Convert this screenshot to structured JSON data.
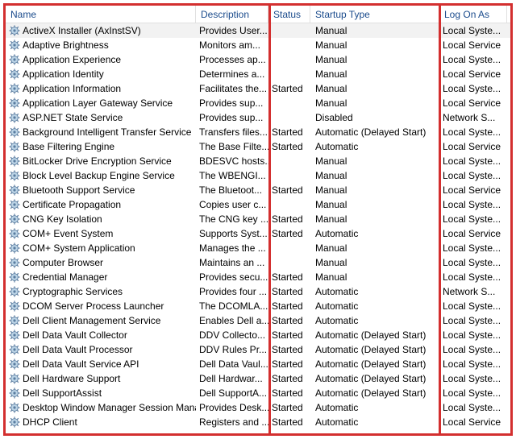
{
  "columns": {
    "name": "Name",
    "description": "Description",
    "status": "Status",
    "startup": "Startup Type",
    "logon": "Log On As"
  },
  "rows": [
    {
      "name": "ActiveX Installer (AxInstSV)",
      "desc": "Provides User...",
      "status": "",
      "startup": "Manual",
      "logon": "Local Syste...",
      "selected": true
    },
    {
      "name": "Adaptive Brightness",
      "desc": "Monitors am...",
      "status": "",
      "startup": "Manual",
      "logon": "Local Service"
    },
    {
      "name": "Application Experience",
      "desc": "Processes ap...",
      "status": "",
      "startup": "Manual",
      "logon": "Local Syste..."
    },
    {
      "name": "Application Identity",
      "desc": "Determines a...",
      "status": "",
      "startup": "Manual",
      "logon": "Local Service"
    },
    {
      "name": "Application Information",
      "desc": "Facilitates the...",
      "status": "Started",
      "startup": "Manual",
      "logon": "Local Syste..."
    },
    {
      "name": "Application Layer Gateway Service",
      "desc": "Provides sup...",
      "status": "",
      "startup": "Manual",
      "logon": "Local Service"
    },
    {
      "name": "ASP.NET State Service",
      "desc": "Provides sup...",
      "status": "",
      "startup": "Disabled",
      "logon": "Network S..."
    },
    {
      "name": "Background Intelligent Transfer Service",
      "desc": "Transfers files...",
      "status": "Started",
      "startup": "Automatic (Delayed Start)",
      "logon": "Local Syste..."
    },
    {
      "name": "Base Filtering Engine",
      "desc": "The Base Filte...",
      "status": "Started",
      "startup": "Automatic",
      "logon": "Local Service"
    },
    {
      "name": "BitLocker Drive Encryption Service",
      "desc": "BDESVC hosts...",
      "status": "",
      "startup": "Manual",
      "logon": "Local Syste..."
    },
    {
      "name": "Block Level Backup Engine Service",
      "desc": "The WBENGI...",
      "status": "",
      "startup": "Manual",
      "logon": "Local Syste..."
    },
    {
      "name": "Bluetooth Support Service",
      "desc": "The Bluetoot...",
      "status": "Started",
      "startup": "Manual",
      "logon": "Local Service"
    },
    {
      "name": "Certificate Propagation",
      "desc": "Copies user c...",
      "status": "",
      "startup": "Manual",
      "logon": "Local Syste..."
    },
    {
      "name": "CNG Key Isolation",
      "desc": "The CNG key ...",
      "status": "Started",
      "startup": "Manual",
      "logon": "Local Syste..."
    },
    {
      "name": "COM+ Event System",
      "desc": "Supports Syst...",
      "status": "Started",
      "startup": "Automatic",
      "logon": "Local Service"
    },
    {
      "name": "COM+ System Application",
      "desc": "Manages the ...",
      "status": "",
      "startup": "Manual",
      "logon": "Local Syste..."
    },
    {
      "name": "Computer Browser",
      "desc": "Maintains an ...",
      "status": "",
      "startup": "Manual",
      "logon": "Local Syste..."
    },
    {
      "name": "Credential Manager",
      "desc": "Provides secu...",
      "status": "Started",
      "startup": "Manual",
      "logon": "Local Syste..."
    },
    {
      "name": "Cryptographic Services",
      "desc": "Provides four ...",
      "status": "Started",
      "startup": "Automatic",
      "logon": "Network S..."
    },
    {
      "name": "DCOM Server Process Launcher",
      "desc": "The DCOMLA...",
      "status": "Started",
      "startup": "Automatic",
      "logon": "Local Syste..."
    },
    {
      "name": "Dell Client Management Service",
      "desc": "Enables Dell a...",
      "status": "Started",
      "startup": "Automatic",
      "logon": "Local Syste..."
    },
    {
      "name": "Dell Data Vault Collector",
      "desc": "DDV Collecto...",
      "status": "Started",
      "startup": "Automatic (Delayed Start)",
      "logon": "Local Syste..."
    },
    {
      "name": "Dell Data Vault Processor",
      "desc": "DDV Rules Pr...",
      "status": "Started",
      "startup": "Automatic (Delayed Start)",
      "logon": "Local Syste..."
    },
    {
      "name": "Dell Data Vault Service API",
      "desc": "Dell Data Vaul...",
      "status": "Started",
      "startup": "Automatic (Delayed Start)",
      "logon": "Local Syste..."
    },
    {
      "name": "Dell Hardware Support",
      "desc": "Dell Hardwar...",
      "status": "Started",
      "startup": "Automatic (Delayed Start)",
      "logon": "Local Syste..."
    },
    {
      "name": "Dell SupportAssist",
      "desc": "Dell SupportA...",
      "status": "Started",
      "startup": "Automatic (Delayed Start)",
      "logon": "Local Syste..."
    },
    {
      "name": "Desktop Window Manager Session Mana...",
      "desc": "Provides Desk...",
      "status": "Started",
      "startup": "Automatic",
      "logon": "Local Syste..."
    },
    {
      "name": "DHCP Client",
      "desc": "Registers and ...",
      "status": "Started",
      "startup": "Automatic",
      "logon": "Local Service"
    }
  ]
}
